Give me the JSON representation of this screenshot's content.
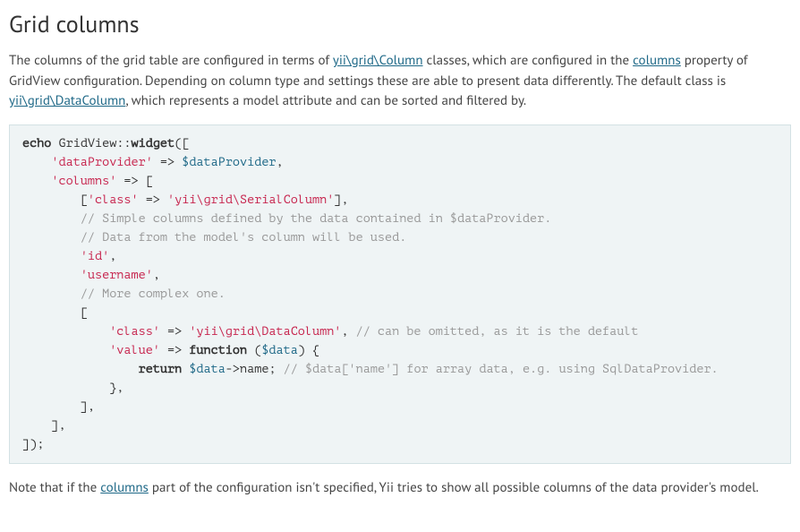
{
  "heading": "Grid columns",
  "para1": {
    "t1": "The columns of the grid table are configured in terms of ",
    "link1": "yii\\grid\\Column",
    "t2": " classes, which are configured in the ",
    "link2": "columns",
    "t3": " property of GridView configuration. Depending on column type and settings these are able to present data differently. The default class is ",
    "link3": "yii\\grid\\DataColumn",
    "t4": ", which represents a model attribute and can be sorted and filtered by."
  },
  "code": {
    "k_echo": "echo",
    "cls": "GridView",
    "mtd": "widget",
    "key_dp": "'dataProvider'",
    "arrow": " => ",
    "var_dp": "$dataProvider",
    "key_cols": "'columns'",
    "br_open": " => [",
    "key_class": "'class'",
    "val_serial": "'yii\\grid\\SerialColumn'",
    "cmt1": "// Simple columns defined by the data contained in $dataProvider.",
    "cmt2": "// Data from the model's column will be used.",
    "val_id": "'id'",
    "val_user": "'username'",
    "cmt3": "// More complex one.",
    "val_datacol": "'yii\\grid\\DataColumn'",
    "cmt4": "// can be omitted, as it is the default",
    "key_value": "'value'",
    "k_function": "function",
    "var_data": "$data",
    "k_return": "return",
    "prop_name": "->name; ",
    "cmt5": "// $data['name'] for array data, e.g. using SqlDataProvider."
  },
  "para2": {
    "t1": "Note that if the ",
    "link1": "columns",
    "t2": " part of the configuration isn't specified, Yii tries to show all possible columns of the data provider's model."
  }
}
